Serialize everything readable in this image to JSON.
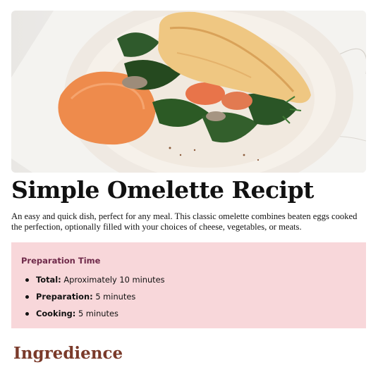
{
  "recipe": {
    "title": "Simple Omelette Recipt",
    "description": "An easy and quick dish, perfect for any meal. This classic omelette combines beaten eggs cooked the perfection, optionally filled with your choices of cheese, vegetables, or meats."
  },
  "preparation": {
    "heading": "Preparation Time",
    "items": [
      {
        "label": "Total:",
        "value": "Aproximately 10 minutes"
      },
      {
        "label": "Preparation:",
        "value": "5 minutes"
      },
      {
        "label": "Cooking:",
        "value": "5 minutes"
      }
    ]
  },
  "ingredients": {
    "heading": "Ingredience"
  },
  "colors": {
    "prep_background": "#f8d7da",
    "prep_heading": "#6f2a4a",
    "ingredients_heading": "#7a3a2a"
  },
  "icons": {
    "list_bullet": "bullet-icon"
  }
}
